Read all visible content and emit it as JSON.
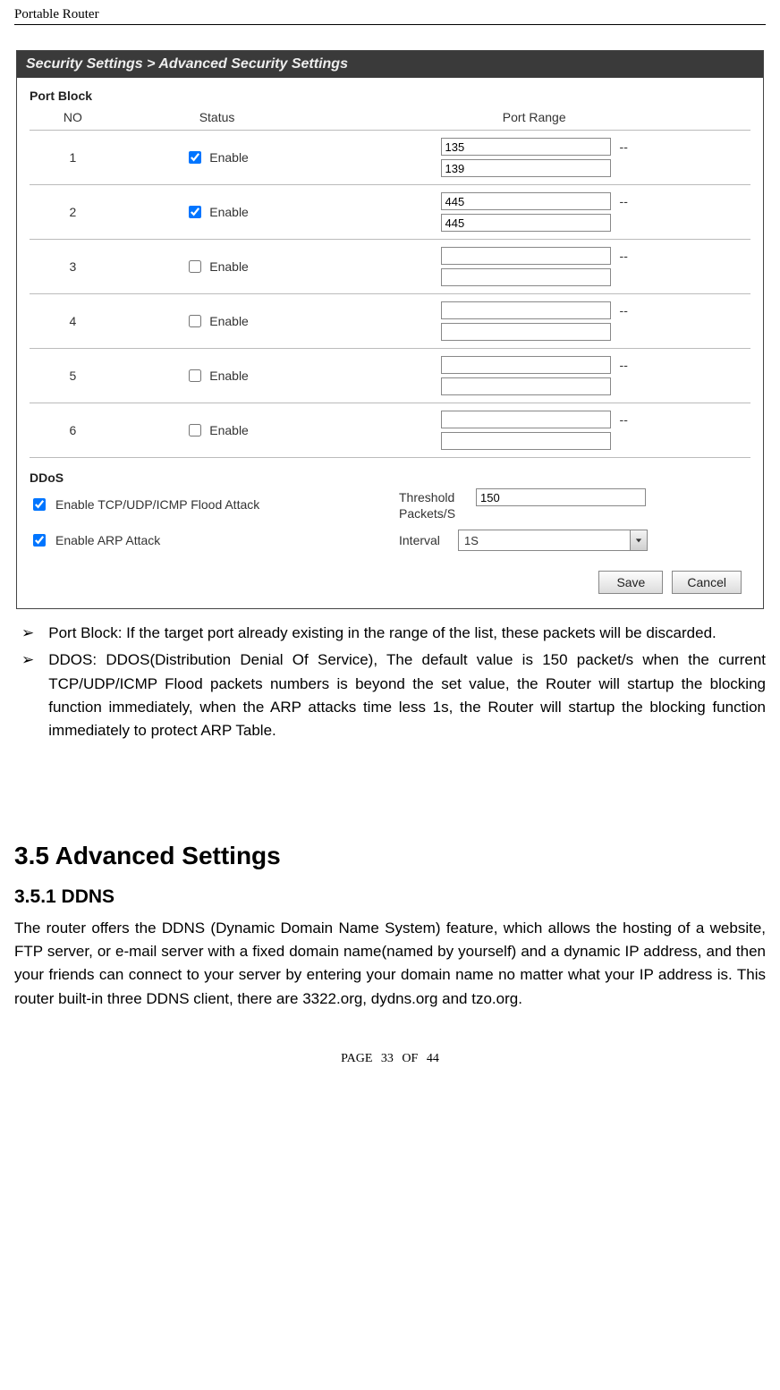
{
  "header": {
    "running_title": "Portable Router"
  },
  "screenshot": {
    "title_bar": "Security Settings > Advanced Security Settings",
    "port_block": {
      "heading": "Port Block",
      "columns": {
        "no": "NO",
        "status": "Status",
        "range": "Port Range"
      },
      "status_label": "Enable",
      "rows": [
        {
          "no": "1",
          "enabled": true,
          "from": "135",
          "to": "139"
        },
        {
          "no": "2",
          "enabled": true,
          "from": "445",
          "to": "445"
        },
        {
          "no": "3",
          "enabled": false,
          "from": "",
          "to": ""
        },
        {
          "no": "4",
          "enabled": false,
          "from": "",
          "to": ""
        },
        {
          "no": "5",
          "enabled": false,
          "from": "",
          "to": ""
        },
        {
          "no": "6",
          "enabled": false,
          "from": "",
          "to": ""
        }
      ]
    },
    "ddos": {
      "heading": "DDoS",
      "flood_label": "Enable TCP/UDP/ICMP Flood Attack",
      "flood_enabled": true,
      "threshold_label_a": "Threshold",
      "threshold_value": "150",
      "threshold_label_b": "Packets/S",
      "arp_label": "Enable ARP Attack",
      "arp_enabled": true,
      "interval_label": "Interval",
      "interval_value": "1S"
    },
    "buttons": {
      "save": "Save",
      "cancel": "Cancel"
    }
  },
  "body": {
    "bullet1": "Port Block: If the target port already existing in the range of the list, these packets will be discarded.",
    "bullet2": "DDOS: DDOS(Distribution Denial Of Service), The default value is 150 packet/s when the current TCP/UDP/ICMP Flood packets numbers is beyond the set value, the Router will startup the blocking function immediately, when the ARP attacks time less 1s, the Router will startup the blocking function immediately to protect ARP Table.",
    "h2": "3.5 Advanced Settings",
    "h3": "3.5.1 DDNS",
    "para": "The router offers the DDNS (Dynamic Domain Name System) feature, which allows the hosting of a website, FTP server, or e-mail server with a fixed domain name(named by yourself) and a dynamic IP address, and then your friends can connect to your server by entering your domain name no matter what your IP address is. This router built-in three DDNS client, there are 3322.org, dydns.org and tzo.org."
  },
  "footer": {
    "text": "PAGE 33 OF 44"
  }
}
